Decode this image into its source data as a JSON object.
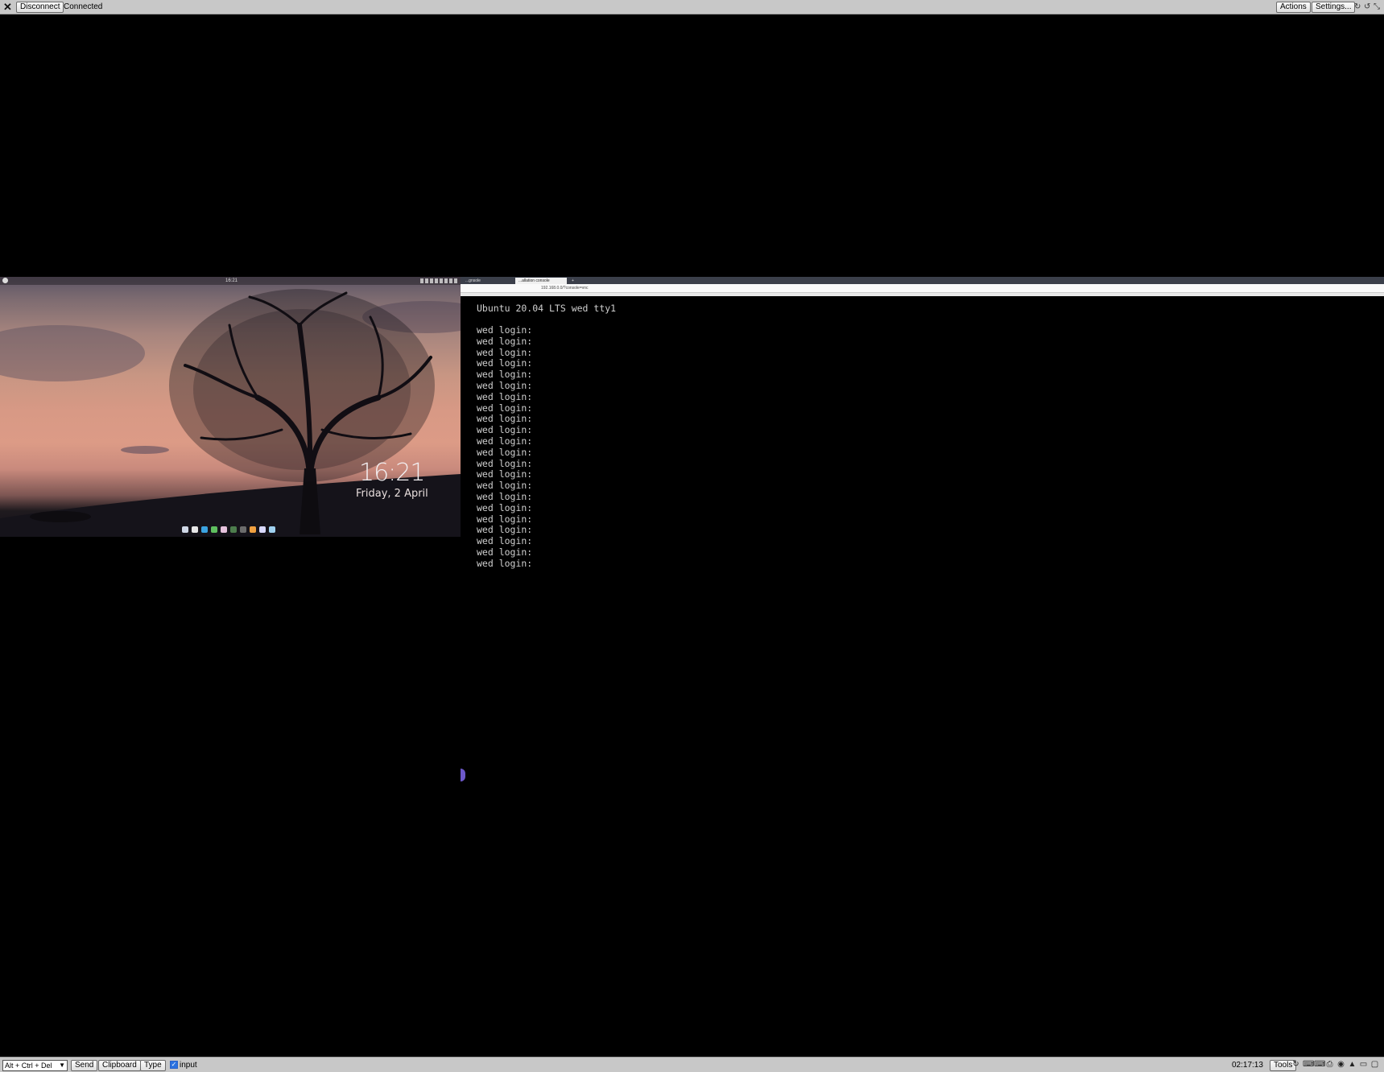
{
  "top_toolbar": {
    "close_glyph": "✕",
    "disconnect_label": "Disconnect",
    "status_text": "Connected",
    "actions_label": "Actions",
    "settings_label": "Settings...",
    "right_icons": [
      "refresh-icon",
      "reload-icon",
      "fullscreen-icon"
    ]
  },
  "left_screen": {
    "panel_title": "16:21",
    "clock_time": "16:21",
    "clock_date": "Friday, 2 April"
  },
  "right_screen": {
    "browser": {
      "tabs": [
        {
          "label": "...gnsole",
          "active": false
        },
        {
          "label": "...allation console",
          "active": true
        }
      ],
      "url": "192.168.0.0/?console=vnc"
    },
    "terminal": {
      "header": "Ubuntu 20.04 LTS wed tty1",
      "prompt": "wed login:",
      "prompt_count": 22
    }
  },
  "bottom_toolbar": {
    "key_combo_value": "Alt + Ctrl + Del",
    "send_label": "Send",
    "clipboard_label": "Clipboard",
    "type_label": "Type",
    "input_checked": true,
    "input_label": "input",
    "time": "02:17:13",
    "tools_label": "Tools",
    "right_icons": [
      "refresh-icon",
      "keyboard-icon",
      "keyboard-alt-icon",
      "printer-icon",
      "camera-icon",
      "bell-icon",
      "monitor-icon",
      "chat-icon"
    ]
  },
  "colors": {
    "toolbar_bg": "#c8c8c8",
    "screen_bg": "#000000",
    "terminal_text": "#cfcfcf",
    "checkbox_accent": "#2a72e0"
  }
}
